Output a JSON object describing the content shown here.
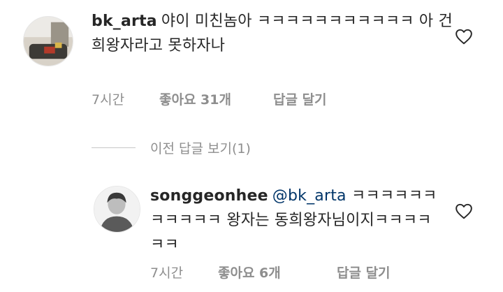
{
  "comments": [
    {
      "username": "bk_arta",
      "mention": "",
      "text": "야이 미친놈아 ㅋㅋㅋㅋㅋㅋㅋㅋㅋㅋㅋ 아 건희왕자라고 못하자나",
      "time": "7시간",
      "likes": "좋아요 31개",
      "reply": "답글 달기",
      "icon": "heart-outline-icon"
    },
    {
      "username": "songgeonhee",
      "mention": "@bk_arta",
      "text": "ㅋㅋㅋㅋㅋㅋㅋㅋㅋㅋㅋ 왕자는 동희왕자님이지ㅋㅋㅋㅋㅋㅋ",
      "time": "7시간",
      "likes": "좋아요 6개",
      "reply": "답글 달기",
      "icon": "heart-outline-icon"
    }
  ],
  "view_previous_replies": "이전 답글 보기(1)",
  "colors": {
    "text": "#262626",
    "secondary": "#8e8e8e",
    "mention": "#003569",
    "divider": "#c7c7c7"
  }
}
